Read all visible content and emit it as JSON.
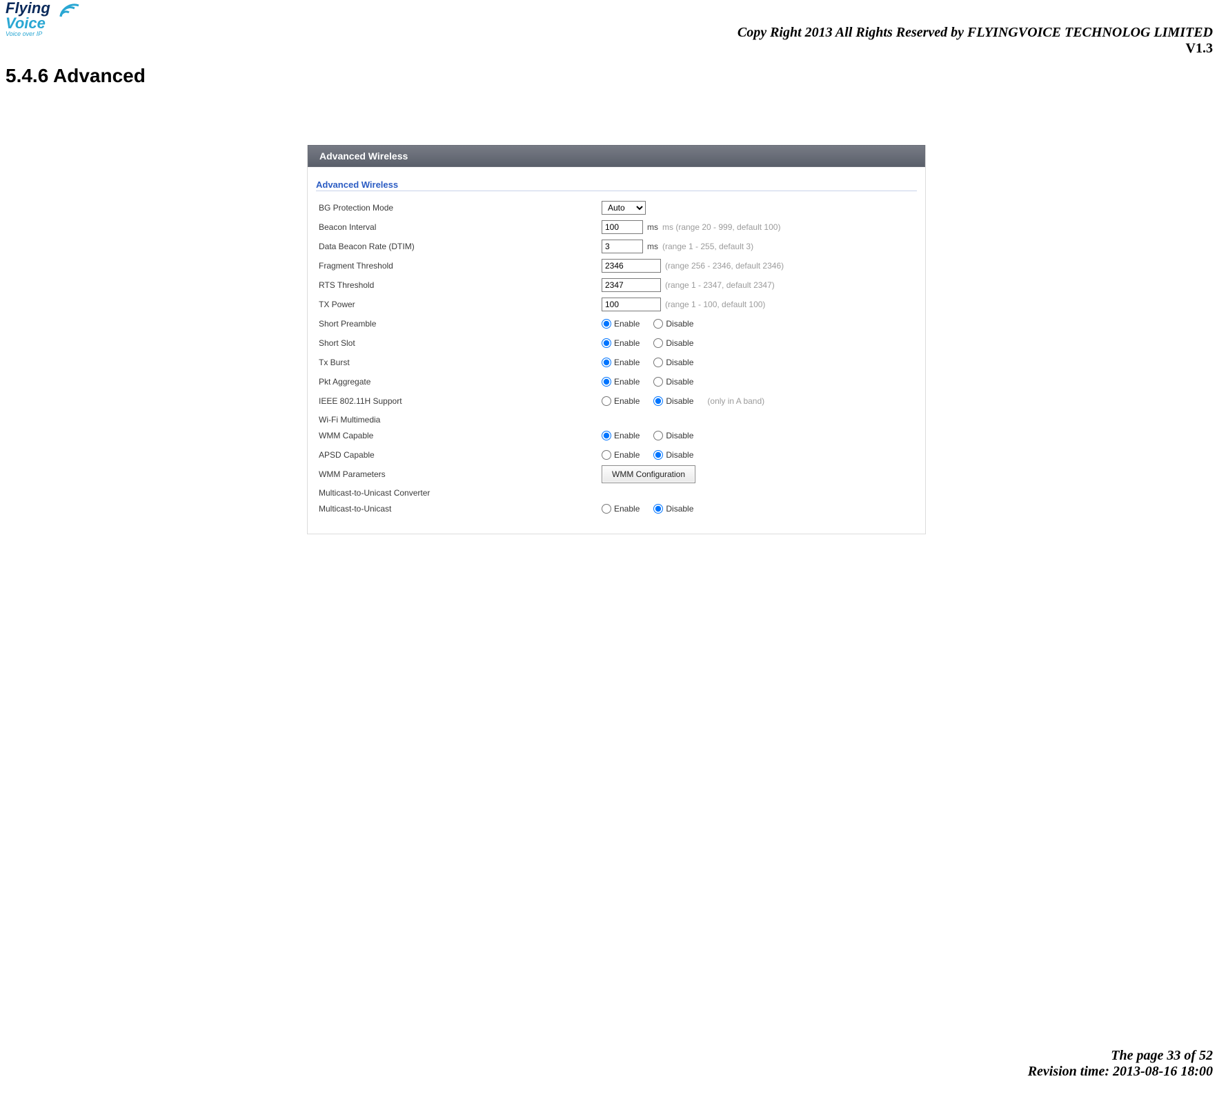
{
  "header": {
    "logo_main1": "Flying",
    "logo_main2": "Voice",
    "logo_sub": "Voice over IP",
    "copyright": "Copy Right 2013 All Rights Reserved by FLYINGVOICE TECHNOLOG LIMITED",
    "version": "V1.3"
  },
  "section": {
    "heading": "5.4.6 Advanced"
  },
  "panel": {
    "titlebar": "Advanced Wireless",
    "subtitle": "Advanced Wireless",
    "fields": {
      "bg_protection": {
        "label": "BG Protection Mode",
        "value": "Auto"
      },
      "beacon_interval": {
        "label": "Beacon Interval",
        "value": "100",
        "unit": "ms",
        "hint": "ms (range 20 - 999, default 100)"
      },
      "dtim": {
        "label": "Data Beacon Rate (DTIM)",
        "value": "3",
        "unit": "ms",
        "hint": "(range 1 - 255, default 3)"
      },
      "fragment": {
        "label": "Fragment Threshold",
        "value": "2346",
        "hint": "(range 256 - 2346, default 2346)"
      },
      "rts": {
        "label": "RTS Threshold",
        "value": "2347",
        "hint": "(range 1 - 2347, default 2347)"
      },
      "txpower": {
        "label": "TX Power",
        "value": "100",
        "hint": "(range 1 - 100, default 100)"
      },
      "short_preamble": {
        "label": "Short Preamble",
        "selected": "enable"
      },
      "short_slot": {
        "label": "Short Slot",
        "selected": "enable"
      },
      "tx_burst": {
        "label": "Tx Burst",
        "selected": "enable"
      },
      "pkt_aggregate": {
        "label": "Pkt Aggregate",
        "selected": "enable"
      },
      "ieee80211h": {
        "label": "IEEE 802.11H Support",
        "selected": "disable",
        "hint": "(only in A band)"
      },
      "wifi_mm_heading": "Wi-Fi Multimedia",
      "wmm_capable": {
        "label": "WMM Capable",
        "selected": "enable"
      },
      "apsd_capable": {
        "label": "APSD Capable",
        "selected": "disable"
      },
      "wmm_parameters": {
        "label": "WMM Parameters",
        "button": "WMM Configuration"
      },
      "mcast_heading": "Multicast-to-Unicast Converter",
      "mcast_to_unicast": {
        "label": "Multicast-to-Unicast",
        "selected": "disable"
      }
    },
    "labels": {
      "enable": "Enable",
      "disable": "Disable"
    }
  },
  "footer": {
    "page_line": "The page 33 of 52",
    "rev_line": "Revision time: 2013-08-16 18:00"
  }
}
